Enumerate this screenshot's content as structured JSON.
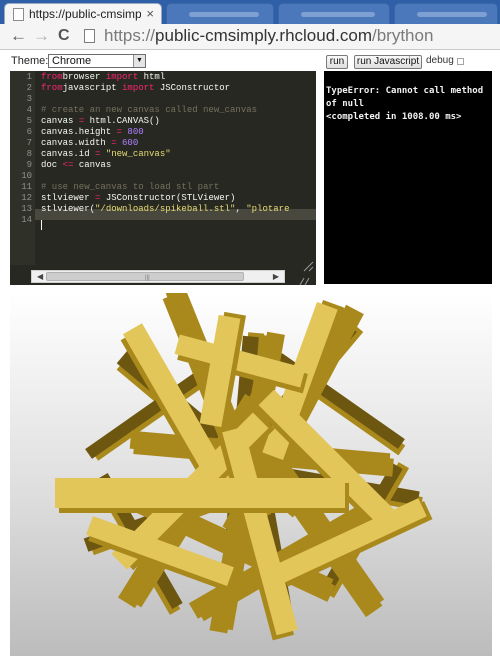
{
  "browser": {
    "active_tab_title": "https://public-cmsimply",
    "tab_close_glyph": "×",
    "url_scheme": "https://",
    "url_host": "public-cmsimply.rhcloud.com",
    "url_path": "/brython",
    "back_glyph": "←",
    "forward_glyph": "→",
    "reload_glyph": "C"
  },
  "editor_bar": {
    "theme_label": "Theme:",
    "theme_value": "Chrome",
    "run_label": "run",
    "run_js_label": "run Javascript",
    "debug_label": "debug"
  },
  "editor": {
    "line_numbers": [
      "1",
      "2",
      "3",
      "4",
      "5",
      "6",
      "7",
      "8",
      "9",
      "10",
      "11",
      "12",
      "13",
      "14"
    ],
    "active_line": 13
  },
  "console": {
    "output": "TypeError: Cannot call method of null\n<completed in 1008.00 ms>"
  },
  "scrollbar": {
    "left_glyph": "◀",
    "right_glyph": "▶",
    "grip_glyph": "|||"
  },
  "canvas": {
    "id": "new_canvas",
    "model": "spikeball.stl",
    "colors": {
      "face": "#e3c65a",
      "side": "#a9891c",
      "dark": "#6d5610"
    }
  },
  "colors": {
    "tabstrip": "#2f5fa6",
    "editor_bg": "#272822",
    "keyword": "#f92672",
    "string": "#e6db74",
    "number": "#ae81ff",
    "comment": "#75715e"
  }
}
